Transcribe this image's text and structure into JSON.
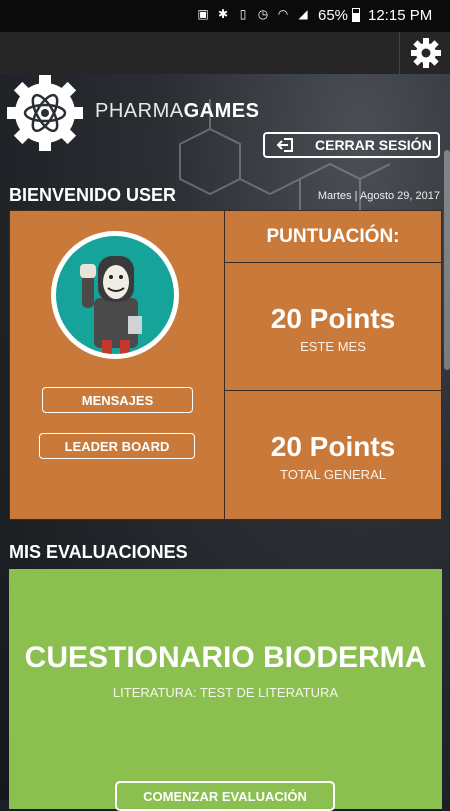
{
  "status_bar": {
    "battery_percent": "65%",
    "time": "12:15 PM"
  },
  "brand": {
    "light": "PHARMA",
    "bold": "GAMES"
  },
  "header": {
    "logout_label": "CERRAR SESIÓN"
  },
  "welcome": {
    "greeting": "BIENVENIDO USER",
    "date": "Martes | Agosto 29, 2017"
  },
  "profile": {
    "messages_label": "MENSAJES",
    "leaderboard_label": "LEADER BOARD"
  },
  "score": {
    "heading": "PUNTUACIÓN:",
    "monthly_value": "20 Points",
    "monthly_label": "ESTE MES",
    "total_value": "20 Points",
    "total_label": "TOTAL GENERAL"
  },
  "evaluations": {
    "heading": "MIS EVALUACIONES",
    "items": [
      {
        "title": "CUESTIONARIO BIODERMA",
        "subtitle": "LITERATURA: TEST DE LITERATURA",
        "start_label": "COMENZAR EVALUACIÓN"
      }
    ]
  },
  "colors": {
    "score_panel": "#c97a3a",
    "quiz_card": "#8bbf4f",
    "avatar_bg": "#16a39a"
  },
  "icons": [
    "gear-icon",
    "atom-logo-icon",
    "logout-icon",
    "bluetooth-icon",
    "wifi-icon",
    "signal-icon",
    "battery-icon"
  ]
}
